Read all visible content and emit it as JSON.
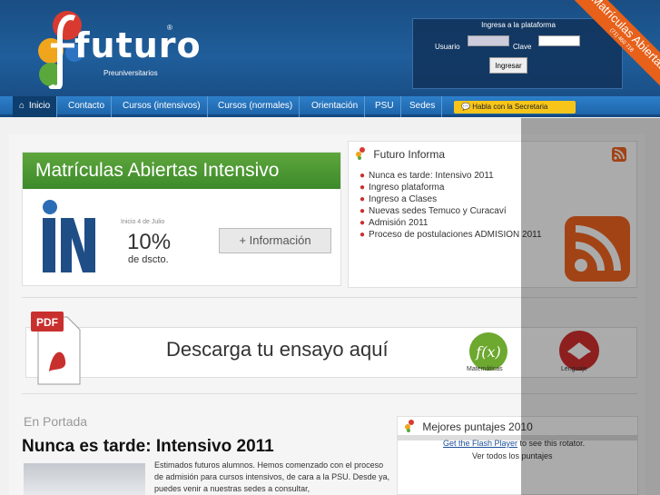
{
  "header": {
    "logo_text": "futuro",
    "logo_sub": "Preuniversitarios",
    "logo_reg": "®",
    "login": {
      "title": "Ingresa a la plataforma",
      "user_label": "Usuario",
      "pass_label": "Clave",
      "user_value": "",
      "pass_value": "",
      "button": "Ingresar"
    },
    "ribbon": {
      "title": "Matrículas Abiertas",
      "sub": "(71) 460 718"
    }
  },
  "nav": {
    "items": [
      "Inicio",
      "Contacto",
      "Cursos (intensivos)",
      "Cursos (normales)",
      "Orientación",
      "PSU",
      "Sedes"
    ],
    "cta": "Habla con la Secretaria"
  },
  "promo": {
    "title": "Matrículas Abiertas Intensivo",
    "date": "Inicio 4 de Julio",
    "pct": "10%",
    "sub": "de dscto.",
    "button": "+ Información"
  },
  "informa": {
    "title": "Futuro Informa",
    "items": [
      "Nunca es tarde: Intensivo 2011",
      "Ingreso plataforma",
      "Ingreso a Clases",
      "Nuevas sedes Temuco y Curacaví",
      "Admisión 2011",
      "Proceso de postulaciones ADMISION 2011"
    ]
  },
  "download": {
    "text": "Descarga tu ensayo aquí",
    "math_label": "Matemáticas",
    "leng_label": "Lenguaje"
  },
  "portada": {
    "label": "En Portada",
    "title": "Nunca es tarde: Intensivo 2011",
    "body": "Estimados futuros alumnos. Hemos comenzado con el proceso de admisión para cursos intensivos, de cara a la PSU. Desde ya, puedes venir a nuestras sedes a consultar,"
  },
  "mejores": {
    "title": "Mejores puntajes 2010",
    "flash_link": "Get the Flash Player",
    "flash_rest": " to see this rotator.",
    "all_link": "Ver todos los puntajes"
  },
  "colors": {
    "header_blue": "#1f5e9b",
    "nav_blue": "#2d7fca",
    "cta_yellow": "#f7c51a",
    "ribbon_orange": "#e7611a",
    "promo_green": "#5ea63d",
    "bullet_red": "#c8302e"
  }
}
